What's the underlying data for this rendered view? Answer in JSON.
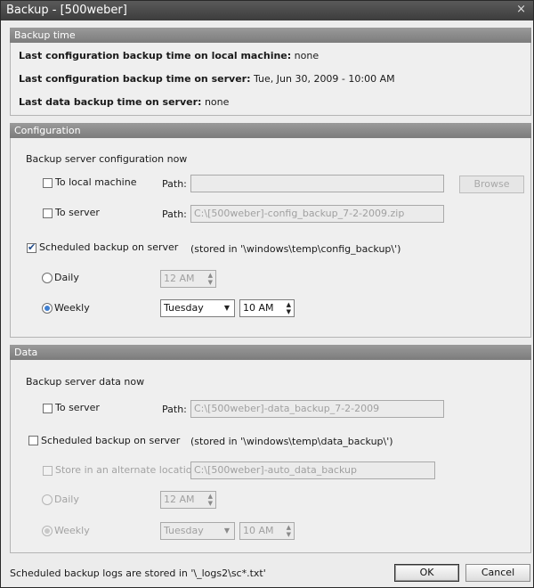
{
  "window": {
    "title": "Backup - [500weber]",
    "close": "×"
  },
  "backup_time": {
    "header": "Backup time",
    "local_label": "Last configuration backup time on local machine:",
    "local_value": "none",
    "server_label": "Last configuration backup time on server:",
    "server_value": "Tue, Jun 30, 2009 - 10:00 AM",
    "data_label": "Last data backup time on server:",
    "data_value": "none"
  },
  "configuration": {
    "header": "Configuration",
    "now_label": "Backup server configuration now",
    "local_machine": {
      "label": "To local machine",
      "checked": false,
      "path_label": "Path:",
      "path_value": "",
      "browse": "Browse"
    },
    "to_server": {
      "label": "To server",
      "checked": false,
      "path_label": "Path:",
      "path_value": "C:\\[500weber]-config_backup_7-2-2009.zip"
    },
    "scheduled": {
      "label": "Scheduled backup on server",
      "checked": true,
      "note": "(stored in '\\windows\\temp\\config_backup\\')"
    },
    "daily": {
      "label": "Daily",
      "selected": false,
      "time": "12 AM"
    },
    "weekly": {
      "label": "Weekly",
      "selected": true,
      "day": "Tuesday",
      "time": "10 AM"
    }
  },
  "data": {
    "header": "Data",
    "now_label": "Backup server data now",
    "to_server": {
      "label": "To server",
      "checked": false,
      "path_label": "Path:",
      "path_value": "C:\\[500weber]-data_backup_7-2-2009"
    },
    "scheduled": {
      "label": "Scheduled backup on server",
      "checked": false,
      "note": "(stored in '\\windows\\temp\\data_backup\\')"
    },
    "alternate": {
      "label": "Store in an alternate location",
      "checked": false,
      "path_value": "C:\\[500weber]-auto_data_backup"
    },
    "daily": {
      "label": "Daily",
      "selected": false,
      "time": "12 AM"
    },
    "weekly": {
      "label": "Weekly",
      "selected": true,
      "day": "Tuesday",
      "time": "10 AM"
    }
  },
  "footer": {
    "logs_note": "Scheduled backup logs are stored in '\\_logs2\\sc*.txt'",
    "ok": "OK",
    "cancel": "Cancel"
  },
  "icons": {
    "checkmark": "✔",
    "spin": "▲▼",
    "dropdown": "▼"
  }
}
